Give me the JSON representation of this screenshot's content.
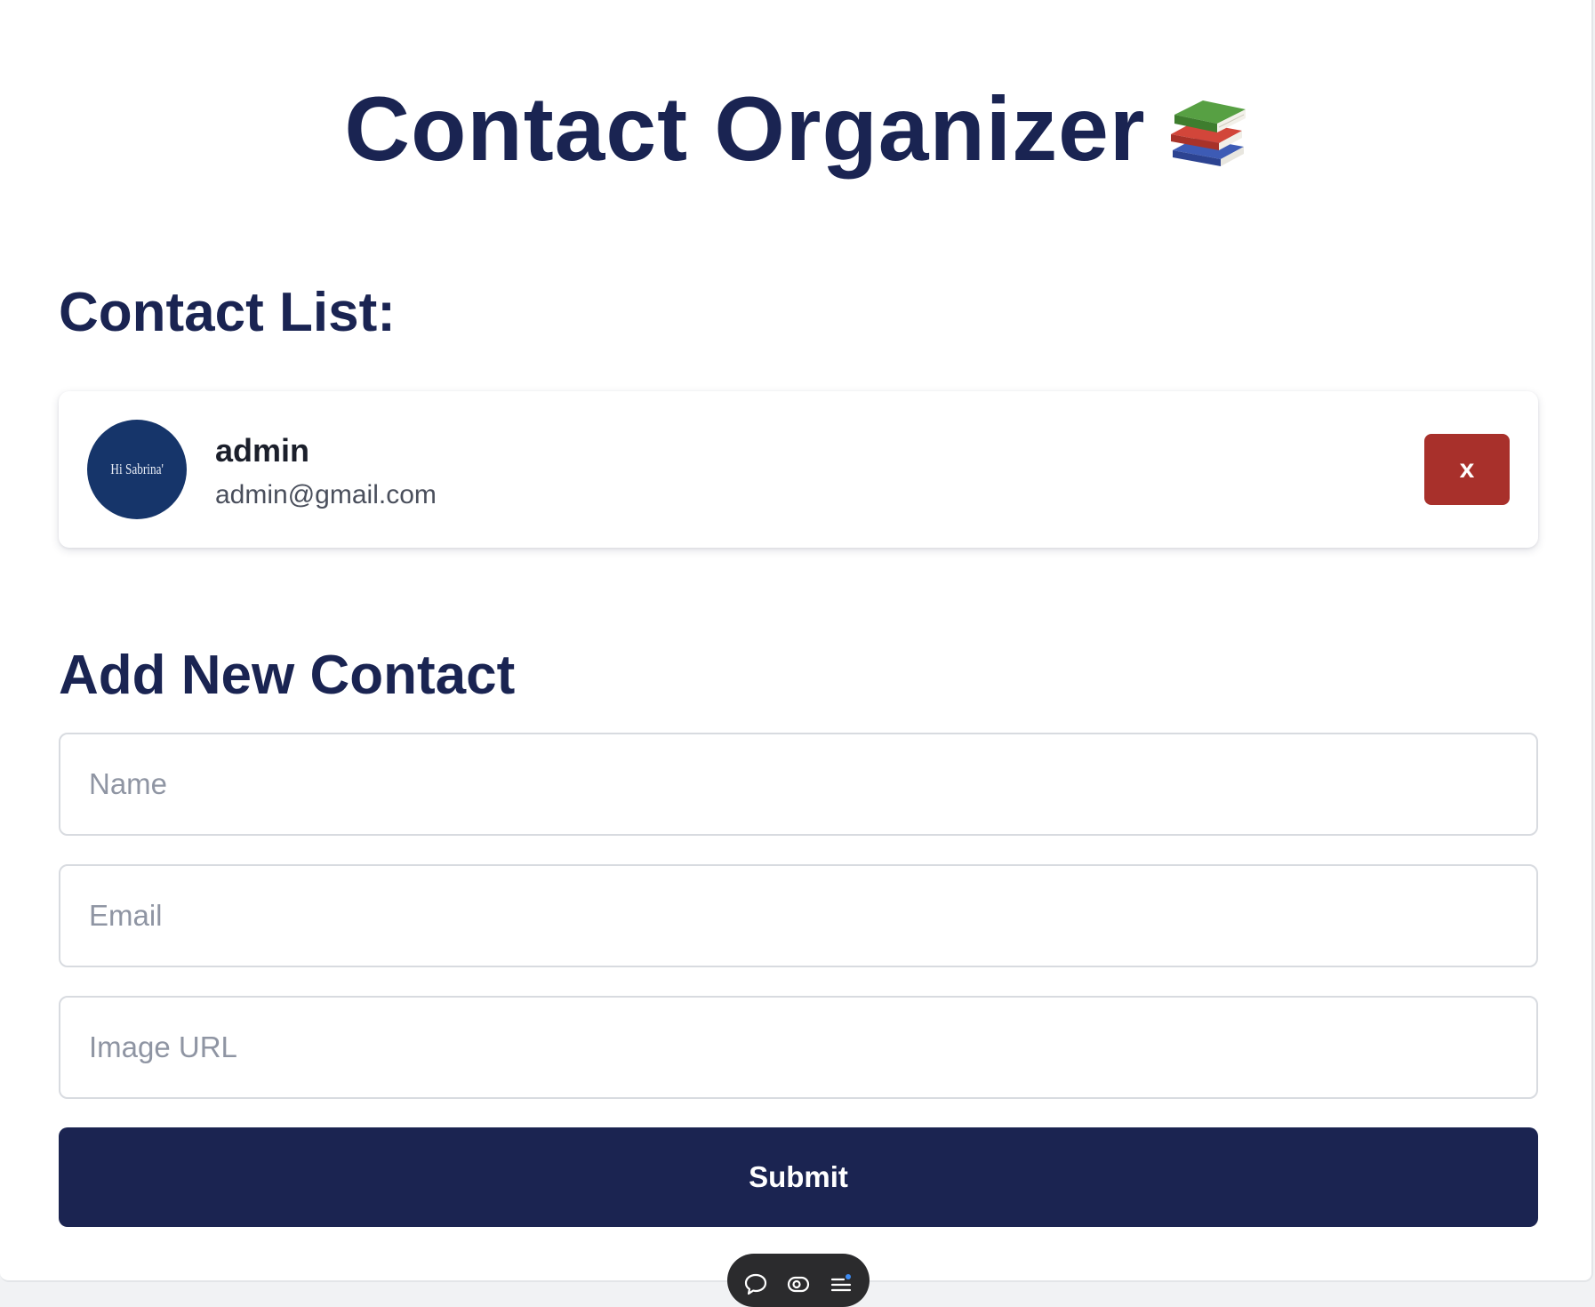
{
  "header": {
    "title": "Contact Organizer"
  },
  "contact_list": {
    "heading": "Contact List:",
    "contacts": [
      {
        "name": "admin",
        "email": "admin@gmail.com",
        "avatar_text": "Hi Sabrina'",
        "delete_label": "x"
      }
    ]
  },
  "add_contact": {
    "heading": "Add New Contact",
    "name_placeholder": "Name",
    "name_value": "",
    "email_placeholder": "Email",
    "email_value": "",
    "image_url_placeholder": "Image URL",
    "image_url_value": "",
    "submit_label": "Submit"
  },
  "toolbar": {
    "icons": [
      "comment-icon",
      "eye-toggle-icon",
      "menu-list-icon"
    ]
  },
  "colors": {
    "heading": "#1a2452",
    "submit_bg": "#1b2451",
    "delete_bg": "#a8302b",
    "avatar_bg": "#16356a"
  },
  "icons": {
    "title_emoji": "books-icon"
  }
}
